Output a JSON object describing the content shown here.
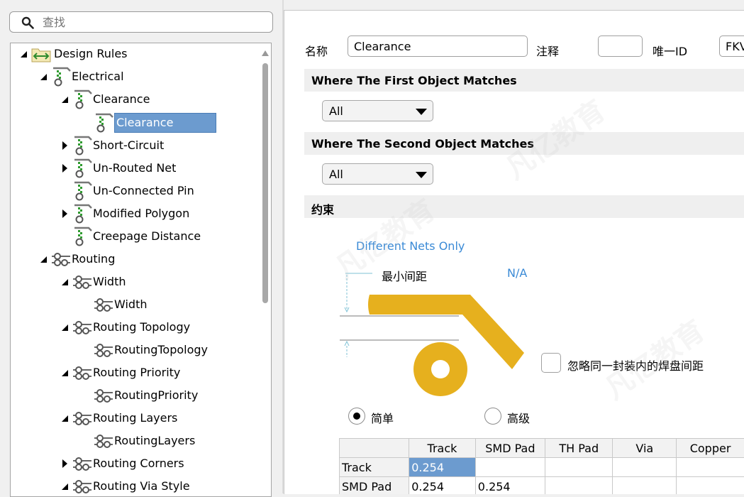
{
  "search": {
    "placeholder": "查找"
  },
  "tree": {
    "items": [
      {
        "label": "Design Rules",
        "icon": "design-rules-icon",
        "arrow": "expanded",
        "level": 0
      },
      {
        "label": "Electrical",
        "icon": "electrical-rule-icon",
        "arrow": "expanded",
        "level": 1
      },
      {
        "label": "Clearance",
        "icon": "clearance-rule-icon",
        "arrow": "expanded",
        "level": 2
      },
      {
        "label": "Clearance",
        "icon": "clearance-rule-icon",
        "arrow": "none",
        "level": 3,
        "selected": true
      },
      {
        "label": "Short-Circuit",
        "icon": "short-circuit-icon",
        "arrow": "collapsed",
        "level": 2
      },
      {
        "label": "Un-Routed Net",
        "icon": "unrouted-net-icon",
        "arrow": "collapsed",
        "level": 2
      },
      {
        "label": "Un-Connected Pin",
        "icon": "unconnected-pin-icon",
        "arrow": "none",
        "level": 2
      },
      {
        "label": "Modified Polygon",
        "icon": "modified-polygon-icon",
        "arrow": "collapsed",
        "level": 2
      },
      {
        "label": "Creepage Distance",
        "icon": "creepage-distance-icon",
        "arrow": "none",
        "level": 2
      },
      {
        "label": "Routing",
        "icon": "routing-icon",
        "arrow": "expanded",
        "level": 1
      },
      {
        "label": "Width",
        "icon": "routing-icon",
        "arrow": "expanded",
        "level": 2
      },
      {
        "label": "Width",
        "icon": "routing-icon",
        "arrow": "none",
        "level": 3
      },
      {
        "label": "Routing Topology",
        "icon": "routing-icon",
        "arrow": "expanded",
        "level": 2
      },
      {
        "label": "RoutingTopology",
        "icon": "routing-icon",
        "arrow": "none",
        "level": 3
      },
      {
        "label": "Routing Priority",
        "icon": "routing-icon",
        "arrow": "expanded",
        "level": 2
      },
      {
        "label": "RoutingPriority",
        "icon": "routing-icon",
        "arrow": "none",
        "level": 3
      },
      {
        "label": "Routing Layers",
        "icon": "routing-icon",
        "arrow": "expanded",
        "level": 2
      },
      {
        "label": "RoutingLayers",
        "icon": "routing-icon",
        "arrow": "none",
        "level": 3
      },
      {
        "label": "Routing Corners",
        "icon": "routing-icon",
        "arrow": "collapsed",
        "level": 2
      },
      {
        "label": "Routing Via Style",
        "icon": "routing-icon",
        "arrow": "expanded",
        "level": 2
      }
    ]
  },
  "rule": {
    "name_label": "名称",
    "name_value": "Clearance",
    "comment_label": "注释",
    "comment_value": "",
    "uid_label": "唯一ID",
    "uid_value": "FKVI"
  },
  "first_match": {
    "title": "Where The First Object Matches",
    "value": "All"
  },
  "second_match": {
    "title": "Where The Second Object Matches",
    "value": "All"
  },
  "constraints": {
    "title": "约束",
    "net_scope": "Different Nets Only",
    "min_clearance_label": "最小间距",
    "min_clearance_value": "N/A",
    "ignore_pads_label": "忽略同一封装内的焊盘间距",
    "mode_simple": "简单",
    "mode_advanced": "高级",
    "selected_mode": "simple"
  },
  "grid": {
    "columns": [
      "Track",
      "SMD Pad",
      "TH Pad",
      "Via",
      "Copper"
    ],
    "rows": [
      {
        "label": "Track",
        "cells": [
          "0.254",
          "",
          "",
          "",
          ""
        ]
      },
      {
        "label": "SMD Pad",
        "cells": [
          "0.254",
          "0.254",
          "",
          "",
          ""
        ]
      }
    ]
  },
  "colors": {
    "selection": "#6c9bcf",
    "copper": "#e6b01e",
    "link": "#3a8ad6",
    "band": "#efefef"
  },
  "watermark": "凡亿教育"
}
